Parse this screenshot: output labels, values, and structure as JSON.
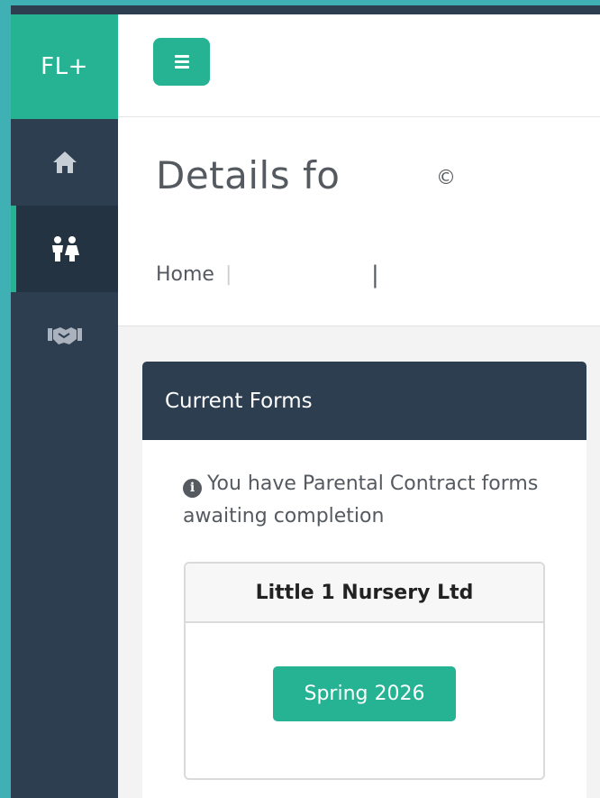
{
  "sidebar": {
    "brand": "FL+",
    "items": [
      {
        "name": "home",
        "icon": "home-icon",
        "active": false
      },
      {
        "name": "children",
        "icon": "children-icon",
        "active": true
      },
      {
        "name": "partners",
        "icon": "handshake-icon",
        "active": false
      }
    ]
  },
  "topbar": {
    "menu_icon": "menu-icon"
  },
  "header": {
    "title": "Details fo",
    "title_mark": "©",
    "breadcrumb": {
      "home": "Home",
      "sep1": "|",
      "sep2": "|"
    }
  },
  "panel": {
    "title": "Current Forms",
    "notice": "You have Parental Contract forms awaiting completion",
    "notice_icon": "info-icon",
    "card": {
      "provider": "Little 1 Nursery Ltd",
      "button_label": "Spring 2026"
    }
  },
  "colors": {
    "accent": "#25b393",
    "dark": "#2c3e50",
    "frame": "#3fb0b4"
  }
}
